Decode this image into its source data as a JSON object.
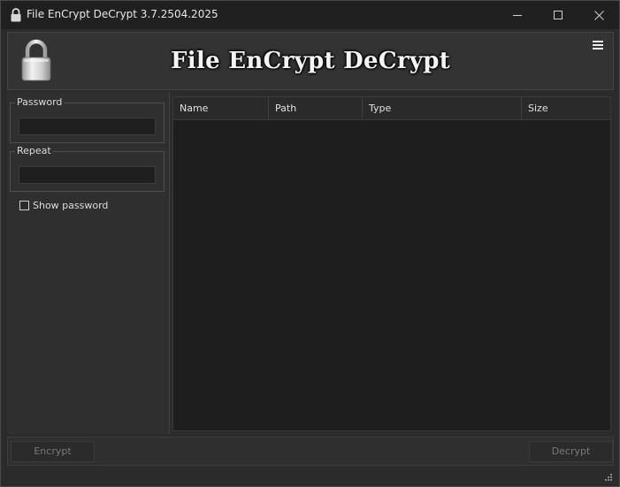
{
  "window": {
    "title": "File EnCrypt DeCrypt 3.7.2504.2025",
    "controls": [
      "minimize",
      "maximize",
      "close"
    ]
  },
  "header": {
    "title": "File EnCrypt DeCrypt",
    "icon": "padlock-icon",
    "menu_icon": "hamburger-menu-icon"
  },
  "left_panel": {
    "password_label": "Password",
    "password_value": "",
    "repeat_label": "Repeat",
    "repeat_value": "",
    "show_password_label": "Show password",
    "show_password_checked": false
  },
  "file_table": {
    "columns": [
      "Name",
      "Path",
      "Type",
      "Size"
    ],
    "rows": []
  },
  "footer": {
    "encrypt_label": "Encrypt",
    "decrypt_label": "Decrypt",
    "encrypt_enabled": false,
    "decrypt_enabled": false
  },
  "colors": {
    "background": "#2b2b2b",
    "titlebar": "#202020",
    "table_background": "#1e1e1e",
    "disabled_text": "#7a7a7a"
  }
}
